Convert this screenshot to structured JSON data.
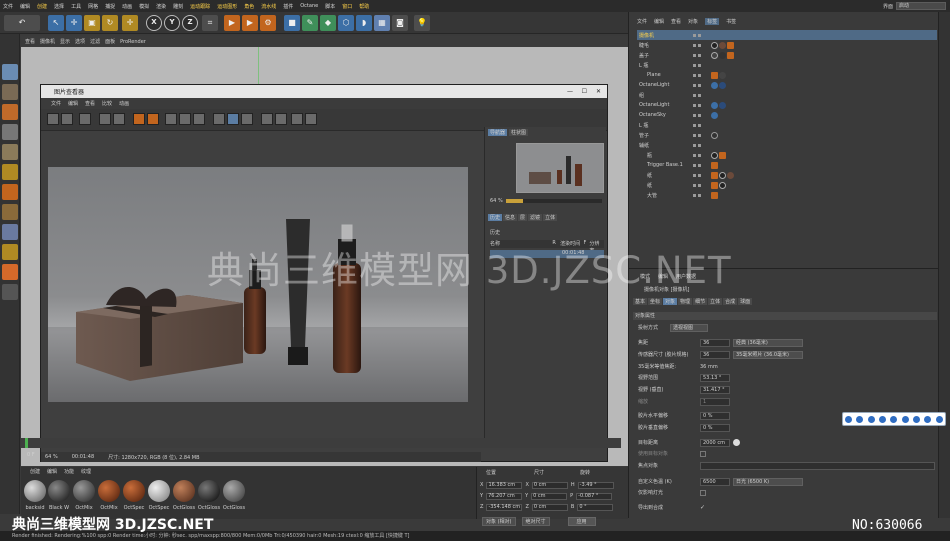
{
  "menu": [
    "文件",
    "编辑",
    "创建",
    "选择",
    "工具",
    "网格",
    "捕捉",
    "动画",
    "模拟",
    "渲染",
    "雕刻",
    "运动跟踪",
    "运动图形",
    "角色",
    "流水线",
    "插件",
    "Octane",
    "脚本",
    "窗口",
    "帮助"
  ],
  "layout_label": "界面",
  "layout_value": "启动",
  "viewport_menu": [
    "查看",
    "摄像机",
    "显示",
    "选项",
    "过滤",
    "面板",
    "ProRender"
  ],
  "picture_viewer": {
    "title": "图片查看器",
    "menu": [
      "文件",
      "编辑",
      "查看",
      "比较",
      "动画"
    ],
    "status": {
      "zoom": "64 %",
      "time": "00:01:48",
      "size_text": "尺寸: 1280x720, RGB (8 位), 2.84 MB"
    },
    "right_tabs": [
      "导航器",
      "柱状图"
    ],
    "nav_zoom": "64 %",
    "history_tabs": [
      "历史",
      "信息",
      "层",
      "滤镜",
      "立体"
    ],
    "history_label": "历史",
    "history_cols": [
      "名称",
      "R",
      "渲染时间",
      "F",
      "分辨率"
    ],
    "history_row_time": "00:01:48"
  },
  "object_manager": {
    "tabs": [
      "文件",
      "编辑",
      "查看",
      "对象",
      "标签",
      "书签"
    ],
    "objects": [
      "摄像机",
      "睫毛",
      "盖子",
      "L 瓶",
      "Plane",
      "OctaneLight",
      "组",
      "OctaneLight",
      "OctaneSky",
      "L 瓶",
      "管子",
      "辅纸",
      "瓶",
      "Trigger Base.1",
      "纸",
      "纸",
      "大管"
    ]
  },
  "attributes": {
    "tabs_top": [
      "模式",
      "编辑",
      "用户数据"
    ],
    "object_title": "摄像机对象 [摄像机]",
    "tabs": [
      "基本",
      "坐标",
      "对象",
      "物理",
      "细节",
      "立体",
      "合成",
      "球面"
    ],
    "section": "对象属性",
    "projection_label": "投射方式",
    "projection_value": "透视视图",
    "rows": [
      {
        "k": "焦距",
        "v": "36",
        "sel": "经典 (36毫米)"
      },
      {
        "k": "传感器尺寸 (胶片规格)",
        "v": "36",
        "sel": "35毫米照片 (36.0毫米)"
      },
      {
        "k": "35毫米等值焦距:",
        "v": "36 mm",
        "sel": ""
      },
      {
        "k": "视野范围",
        "v": "53.13 °",
        "sel": ""
      },
      {
        "k": "视野 (垂直)",
        "v": "31.417 °",
        "sel": ""
      },
      {
        "k": "缩放",
        "v": "1",
        "sel": ""
      },
      {
        "k": "胶片水平偏移",
        "v": "0 %",
        "sel": ""
      },
      {
        "k": "胶片垂直偏移",
        "v": "0 %",
        "sel": ""
      },
      {
        "k": "目标距离",
        "v": "2000 cm",
        "sel": ""
      },
      {
        "k": "使用目标对象",
        "v": "",
        "sel": ""
      },
      {
        "k": "焦点对象",
        "v": "",
        "sel": ""
      },
      {
        "k": "自定义色温 (K)",
        "v": "6500",
        "sel": "日光 (6500 K)"
      },
      {
        "k": "仅影响灯光",
        "v": "",
        "sel": ""
      },
      {
        "k": "导出到合成",
        "v": "",
        "sel": ""
      }
    ]
  },
  "materials": {
    "tabs": [
      "创建",
      "编辑",
      "功能",
      "纹理"
    ],
    "items": [
      "backsid",
      "Black W",
      "OctMix",
      "OctMix",
      "OctSpec",
      "OctSpec",
      "OctGloss",
      "OctGloss",
      "OctGloss"
    ]
  },
  "coordinates": {
    "headers": [
      "位置",
      "尺寸",
      "旋转"
    ],
    "rows": [
      {
        "axis": "X",
        "pos": "16.383 cm",
        "size": "0 cm",
        "rot_k": "H",
        "rot": "-3.49 °"
      },
      {
        "axis": "Y",
        "pos": "76.207 cm",
        "size": "0 cm",
        "rot_k": "P",
        "rot": "-0.087 °"
      },
      {
        "axis": "Z",
        "pos": "-354.148 cm",
        "size": "0 cm",
        "rot_k": "B",
        "rot": "0 °"
      }
    ],
    "mode1": "对象 (相对)",
    "mode2": "绝对尺寸",
    "apply": "应用"
  },
  "status_bar": "Render finished: Rendering:%100 spp:0 Render time:小时: 分钟: 秒sec. spp/maxspp:800/800 Mem:0/0Mb Tri:0/450390 hair:0 Mesh:19 ctexl:0       缩放工具 [快捷键 T]",
  "watermark_center": "典尚三维模型网 3D.JZSC.NET",
  "watermark_left": "典尚三维模型网 3D.JZSC.NET",
  "watermark_no": "NO:630066",
  "timeline_frame": "0 F"
}
